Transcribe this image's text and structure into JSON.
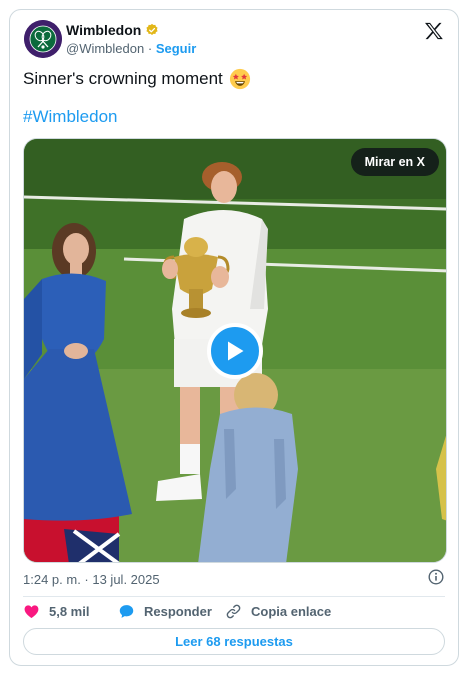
{
  "author": {
    "name": "Wimbledon",
    "handle": "@Wimbledon",
    "separator": "·",
    "follow_label": "Seguir",
    "avatar_text": "THE CHAMPIONSHIPS · WIMBLEDON"
  },
  "tweet": {
    "text": "Sinner's crowning moment",
    "emoji": "star-struck-emoji",
    "hashtag": "#Wimbledon"
  },
  "media": {
    "watch_label": "Mirar en X"
  },
  "footer": {
    "timestamp": "1:24 p. m. · 13 jul. 2025",
    "likes": "5,8 mil",
    "reply_label": "Responder",
    "copy_label": "Copia enlace",
    "read_replies_label": "Leer 68 respuestas"
  },
  "colors": {
    "accent": "#1d9bf0",
    "like": "#f91880",
    "text_secondary": "#536471",
    "brand_purple": "#3f1f6b",
    "brand_green": "#0b6a3c"
  }
}
